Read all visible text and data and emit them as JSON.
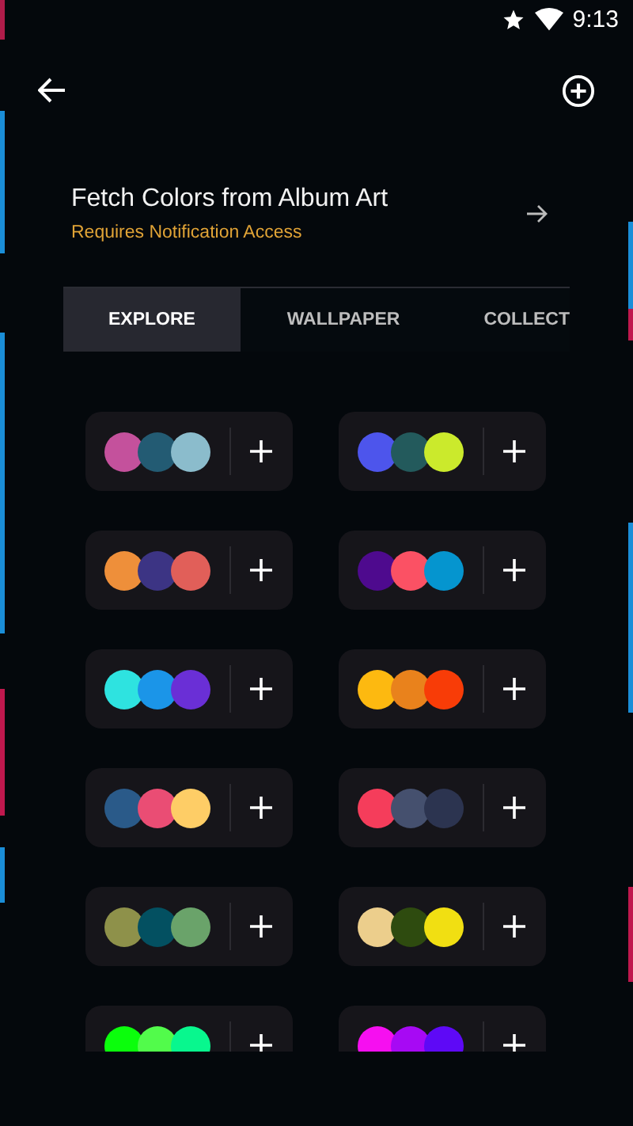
{
  "status_bar": {
    "time": "9:13"
  },
  "feature": {
    "title": "Fetch Colors from Album Art",
    "subtitle": "Requires Notification Access"
  },
  "tabs": [
    {
      "label": "EXPLORE",
      "selected": true
    },
    {
      "label": "WALLPAPER",
      "selected": false
    },
    {
      "label": "COLLECT",
      "selected": false
    }
  ],
  "palettes": [
    {
      "swatches": [
        {
          "color": "#c4519c"
        },
        {
          "color": "#235b73"
        },
        {
          "color": "#8bbccc"
        }
      ]
    },
    {
      "swatches": [
        {
          "color": "#4d55ec"
        },
        {
          "color": "#235a5c"
        },
        {
          "color": "#cbea2c"
        }
      ]
    },
    {
      "swatches": [
        {
          "color": "#ee8f3a"
        },
        {
          "color": "#3c3484"
        },
        {
          "color": "#e15f59"
        }
      ]
    },
    {
      "swatches": [
        {
          "color": "#4e0a8e"
        },
        {
          "color": "#fb5164"
        },
        {
          "color": "#0595cf"
        }
      ]
    },
    {
      "swatches": [
        {
          "color": "#2ee3e0"
        },
        {
          "color": "#1b95e8"
        },
        {
          "color": "#6a2fd6"
        }
      ]
    },
    {
      "swatches": [
        {
          "color": "#fdb910"
        },
        {
          "color": "#e9821c"
        },
        {
          "color": "#f83c07"
        }
      ]
    },
    {
      "swatches": [
        {
          "color": "#2a5a89"
        },
        {
          "color": "#ea4d74"
        },
        {
          "color": "#fecd66"
        }
      ]
    },
    {
      "swatches": [
        {
          "color": "#f53d5b"
        },
        {
          "color": "#45506e"
        },
        {
          "color": "#2c3450"
        }
      ]
    },
    {
      "swatches": [
        {
          "color": "#8e914a"
        },
        {
          "color": "#035061"
        },
        {
          "color": "#6aa36a"
        }
      ]
    },
    {
      "swatches": [
        {
          "color": "#ecce8c"
        },
        {
          "color": "#2e4b0f"
        },
        {
          "color": "#f1df12"
        }
      ]
    },
    {
      "swatches": [
        {
          "color": "#0bfe0c"
        },
        {
          "color": "#52fb4b"
        },
        {
          "color": "#08f78e"
        }
      ]
    },
    {
      "swatches": [
        {
          "color": "#f60ff0"
        },
        {
          "color": "#a709f4"
        },
        {
          "color": "#5e09f6"
        }
      ]
    }
  ]
}
